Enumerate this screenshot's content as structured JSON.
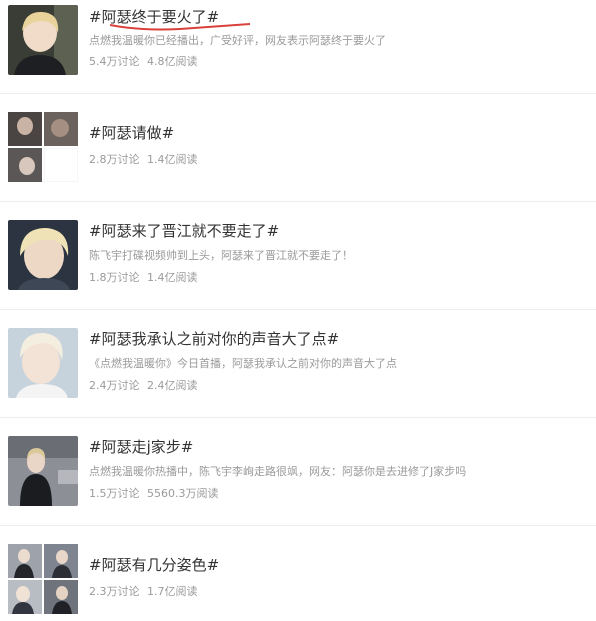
{
  "topics": [
    {
      "title": "#阿瑟终于要火了#",
      "desc": "点燃我温暖你已经播出，广受好评，网友表示阿瑟终于要火了",
      "discussions": "5.4万讨论",
      "reads": "4.8亿阅读",
      "thumb_type": "single"
    },
    {
      "title": "#阿瑟请做#",
      "discussions": "2.8万讨论",
      "reads": "1.4亿阅读",
      "thumb_type": "grid"
    },
    {
      "title": "#阿瑟来了晋江就不要走了#",
      "desc": "陈飞宇打碟视频帅到上头，阿瑟来了晋江就不要走了！",
      "discussions": "1.8万讨论",
      "reads": "1.4亿阅读",
      "thumb_type": "single"
    },
    {
      "title": "#阿瑟我承认之前对你的声音大了点#",
      "desc": "《点燃我温暖你》今日首播，阿瑟我承认之前对你的声音大了点",
      "discussions": "2.4万讨论",
      "reads": "2.4亿阅读",
      "thumb_type": "single"
    },
    {
      "title": "#阿瑟走j家步#",
      "desc": "点燃我温暖你热播中，陈飞宇李峋走路很飒，网友：阿瑟你是去进修了J家步吗",
      "discussions": "1.5万讨论",
      "reads": "5560.3万阅读",
      "thumb_type": "single"
    },
    {
      "title": "#阿瑟有几分姿色#",
      "discussions": "2.3万讨论",
      "reads": "1.7亿阅读",
      "thumb_type": "grid"
    }
  ],
  "colors": {
    "underline": "#d9413a",
    "title": "#333333",
    "meta": "#9a9a9a"
  }
}
